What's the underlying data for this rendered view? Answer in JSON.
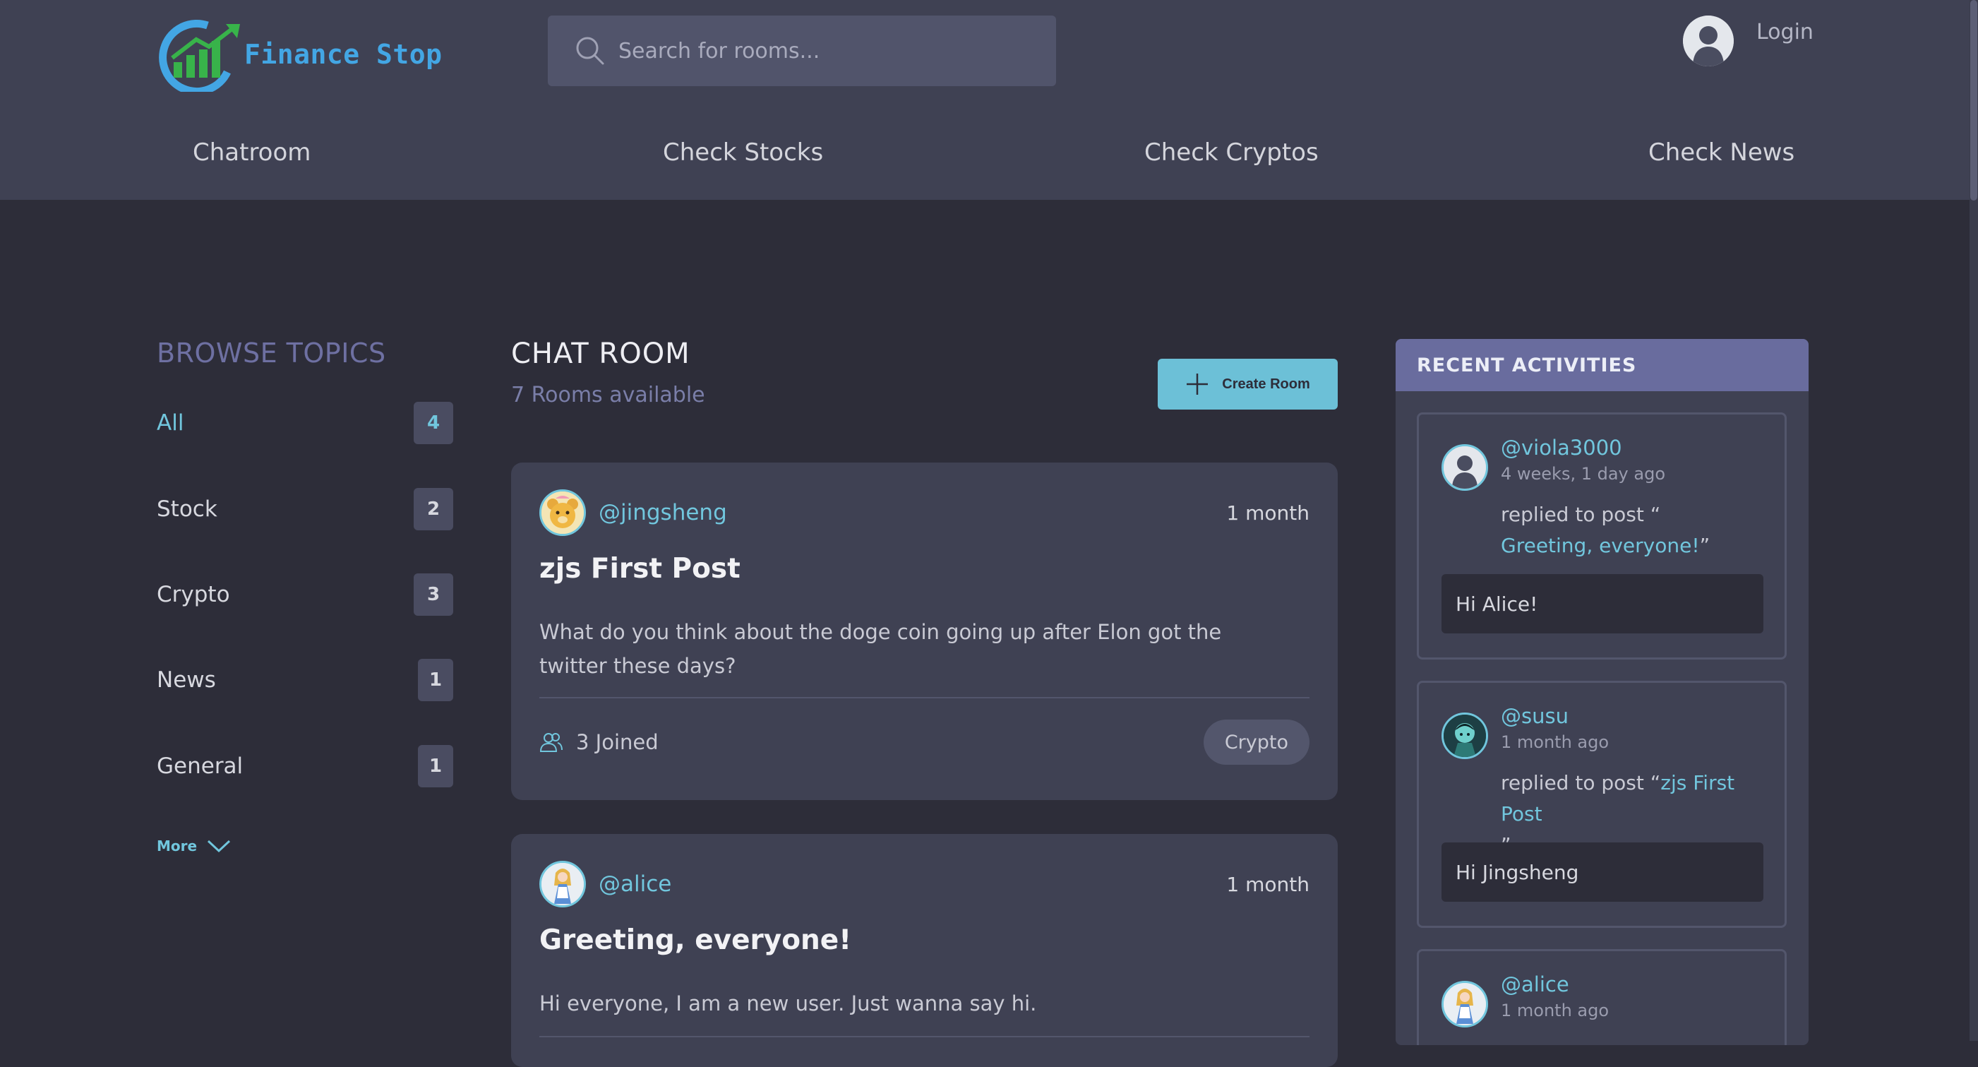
{
  "brand": {
    "name": "Finance Stop",
    "colors": {
      "accent": "#71c6dd",
      "logo": "#43a6e4",
      "logo_green": "#38b34a"
    }
  },
  "search": {
    "placeholder": "Search for rooms..."
  },
  "header": {
    "login_label": "Login"
  },
  "nav": [
    "Chatroom",
    "Check Stocks",
    "Check Cryptos",
    "Check News"
  ],
  "sidebar": {
    "title": "BROWSE TOPICS",
    "topics": [
      {
        "label": "All",
        "count": "4"
      },
      {
        "label": "Stock",
        "count": "2"
      },
      {
        "label": "Crypto",
        "count": "3"
      },
      {
        "label": "News",
        "count": "1"
      },
      {
        "label": "General",
        "count": "1"
      }
    ],
    "more_label": "More"
  },
  "main": {
    "title": "CHAT ROOM",
    "subtitle": "7 Rooms available",
    "create_label": "Create Room",
    "rooms": [
      {
        "user": "@jingsheng",
        "time": "1 month",
        "title": "zjs First Post",
        "desc": "What do you think about the doge coin going up after Elon got the twitter these days?",
        "joined": "3 Joined",
        "tag": "Crypto"
      },
      {
        "user": "@alice",
        "time": "1 month",
        "title": "Greeting, everyone!",
        "desc": "Hi everyone, I am a new user. Just wanna say hi."
      }
    ]
  },
  "activities": {
    "title": "RECENT ACTIVITIES",
    "items": [
      {
        "user": "@viola3000",
        "time": "4 weeks, 1 day ago",
        "prefix": "replied to post “",
        "post": "Greeting, everyone!",
        "suffix": "”",
        "reply": "Hi Alice!"
      },
      {
        "user": "@susu",
        "time": "1 month ago",
        "prefix": "replied to post “",
        "post": "zjs First Post",
        "suffix": "”",
        "reply": "Hi Jingsheng"
      },
      {
        "user": "@alice",
        "time": "1 month ago"
      }
    ]
  }
}
